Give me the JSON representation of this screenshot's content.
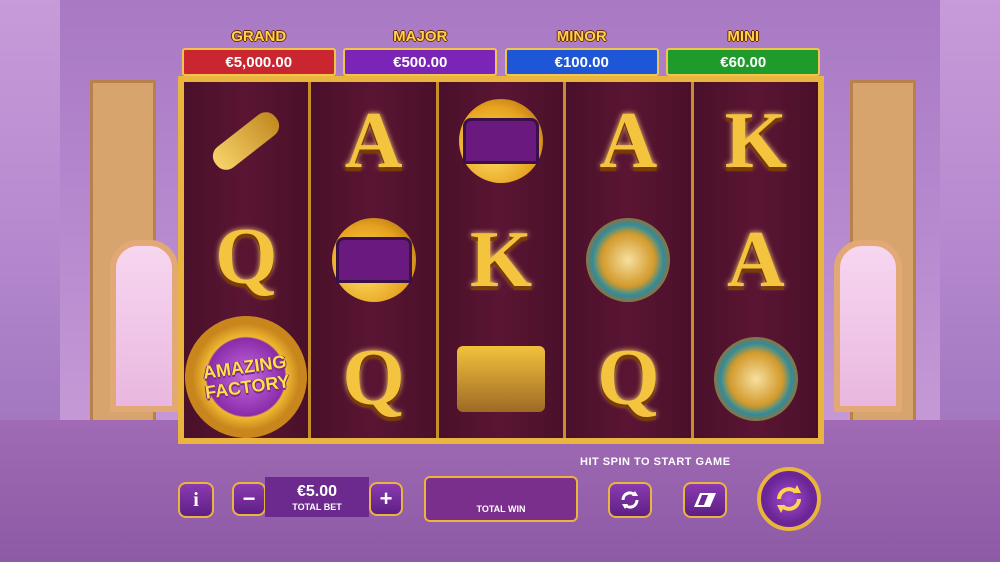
{
  "jackpots": [
    {
      "name": "GRAND",
      "value": "€5,000.00",
      "color": "#c9262f"
    },
    {
      "name": "MAJOR",
      "value": "€500.00",
      "color": "#7b25b8"
    },
    {
      "name": "MINOR",
      "value": "€100.00",
      "color": "#1d56d6"
    },
    {
      "name": "MINI",
      "value": "€60.00",
      "color": "#1e9b2a"
    }
  ],
  "reels": [
    [
      "key",
      "Q",
      "logo"
    ],
    [
      "A",
      "hat-coins",
      "Q"
    ],
    [
      "hat-coins",
      "K",
      "cart"
    ],
    [
      "A",
      "watch",
      "Q"
    ],
    [
      "K",
      "A",
      "watch"
    ]
  ],
  "symbols": {
    "letters": {
      "A": "A",
      "K": "K",
      "Q": "Q"
    },
    "logo_line1": "AMAZING",
    "logo_line2": "FACTORY"
  },
  "controls": {
    "hint": "HIT SPIN TO START GAME",
    "info_label": "i",
    "minus_label": "−",
    "plus_label": "+",
    "bet_value": "€5.00",
    "bet_label": "TOTAL BET",
    "win_label": "TOTAL WIN"
  },
  "colors": {
    "gold": "#e9b53f",
    "reel_bg": "#4a1029",
    "button_bg": "#6d2a8e"
  }
}
